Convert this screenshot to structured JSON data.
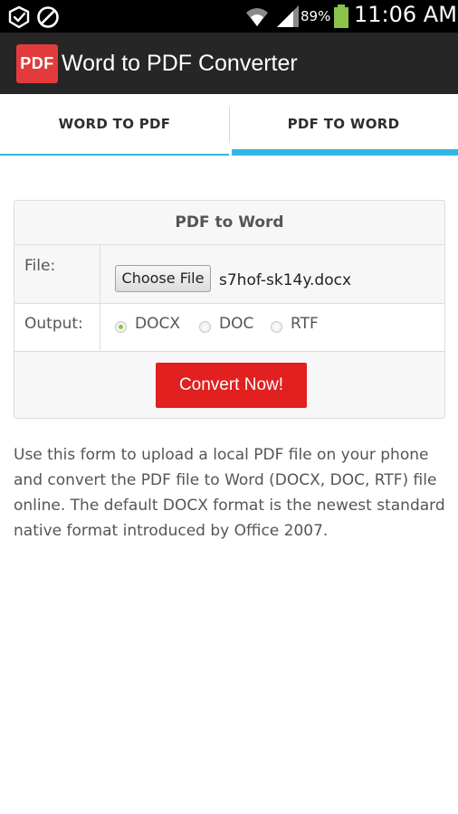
{
  "status_bar": {
    "battery_percent": "89%",
    "time": "11:06 AM",
    "icons": [
      "cube-check-icon",
      "no-disturb-icon",
      "wifi-icon",
      "signal-icon",
      "battery-icon"
    ]
  },
  "app": {
    "logo_text": "PDF",
    "title": "Word to PDF Converter",
    "brand_color": "#e33b3b"
  },
  "tabs": [
    {
      "label": "WORD TO PDF",
      "active": false
    },
    {
      "label": "PDF TO WORD",
      "active": true
    }
  ],
  "form": {
    "title": "PDF to Word",
    "file_label": "File:",
    "choose_button": "Choose File",
    "file_name": "s7hof-sk14y.docx",
    "output_label": "Output:",
    "options": [
      {
        "label": "DOCX",
        "selected": true
      },
      {
        "label": "DOC",
        "selected": false
      },
      {
        "label": "RTF",
        "selected": false
      }
    ],
    "convert_button": "Convert Now!",
    "accent_color": "#e1201f"
  },
  "description": "Use this form to upload a local PDF file on your phone and convert the PDF file to Word (DOCX, DOC, RTF) file online. The default DOCX format is the newest standard native format introduced by Office 2007."
}
